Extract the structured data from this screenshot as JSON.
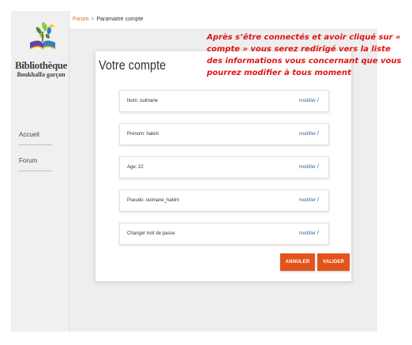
{
  "brand": {
    "name": "Bibliothèque",
    "subtitle": "Boukhalfa garçon",
    "logo_icon": "book-tree-logo",
    "colors": {
      "green_light": "#8dc63f",
      "green_dark": "#4a8a2a",
      "purple": "#6b3fa0",
      "blue": "#3a7ac0",
      "yellow": "#f2c21a"
    }
  },
  "sidebar": {
    "items": [
      {
        "label": "Accueil"
      },
      {
        "label": "Forum"
      }
    ]
  },
  "breadcrumb": {
    "root": "Forum",
    "separator": ">",
    "current": "Paramaitre compte"
  },
  "account": {
    "title": "Votre compte",
    "fields": [
      {
        "text": "Nom: oulmane",
        "action": "modifier"
      },
      {
        "text": "Prenom: hakim",
        "action": "modifier"
      },
      {
        "text": "Age: 22",
        "action": "modifier"
      },
      {
        "text": "Pseudo: oulmane_hakim",
        "action": "modifier"
      },
      {
        "text": "Changer mot de passe",
        "action": "modifier"
      }
    ],
    "edit_icon": "pencil-icon",
    "edit_glyph": "/",
    "buttons": {
      "cancel": "ANNULER",
      "confirm": "VALIDER"
    }
  },
  "annotation": {
    "text": "Après s’être connectés et  avoir cliqué sur « compte » vous serez redirigé vers la liste des informations vous concernant que vous pourrez modifier  à tous moment"
  },
  "colors": {
    "accent": "#e2541c",
    "link": "#3a67a8",
    "annotation": "#e01414",
    "breadcrumb_link": "#e0641e"
  }
}
